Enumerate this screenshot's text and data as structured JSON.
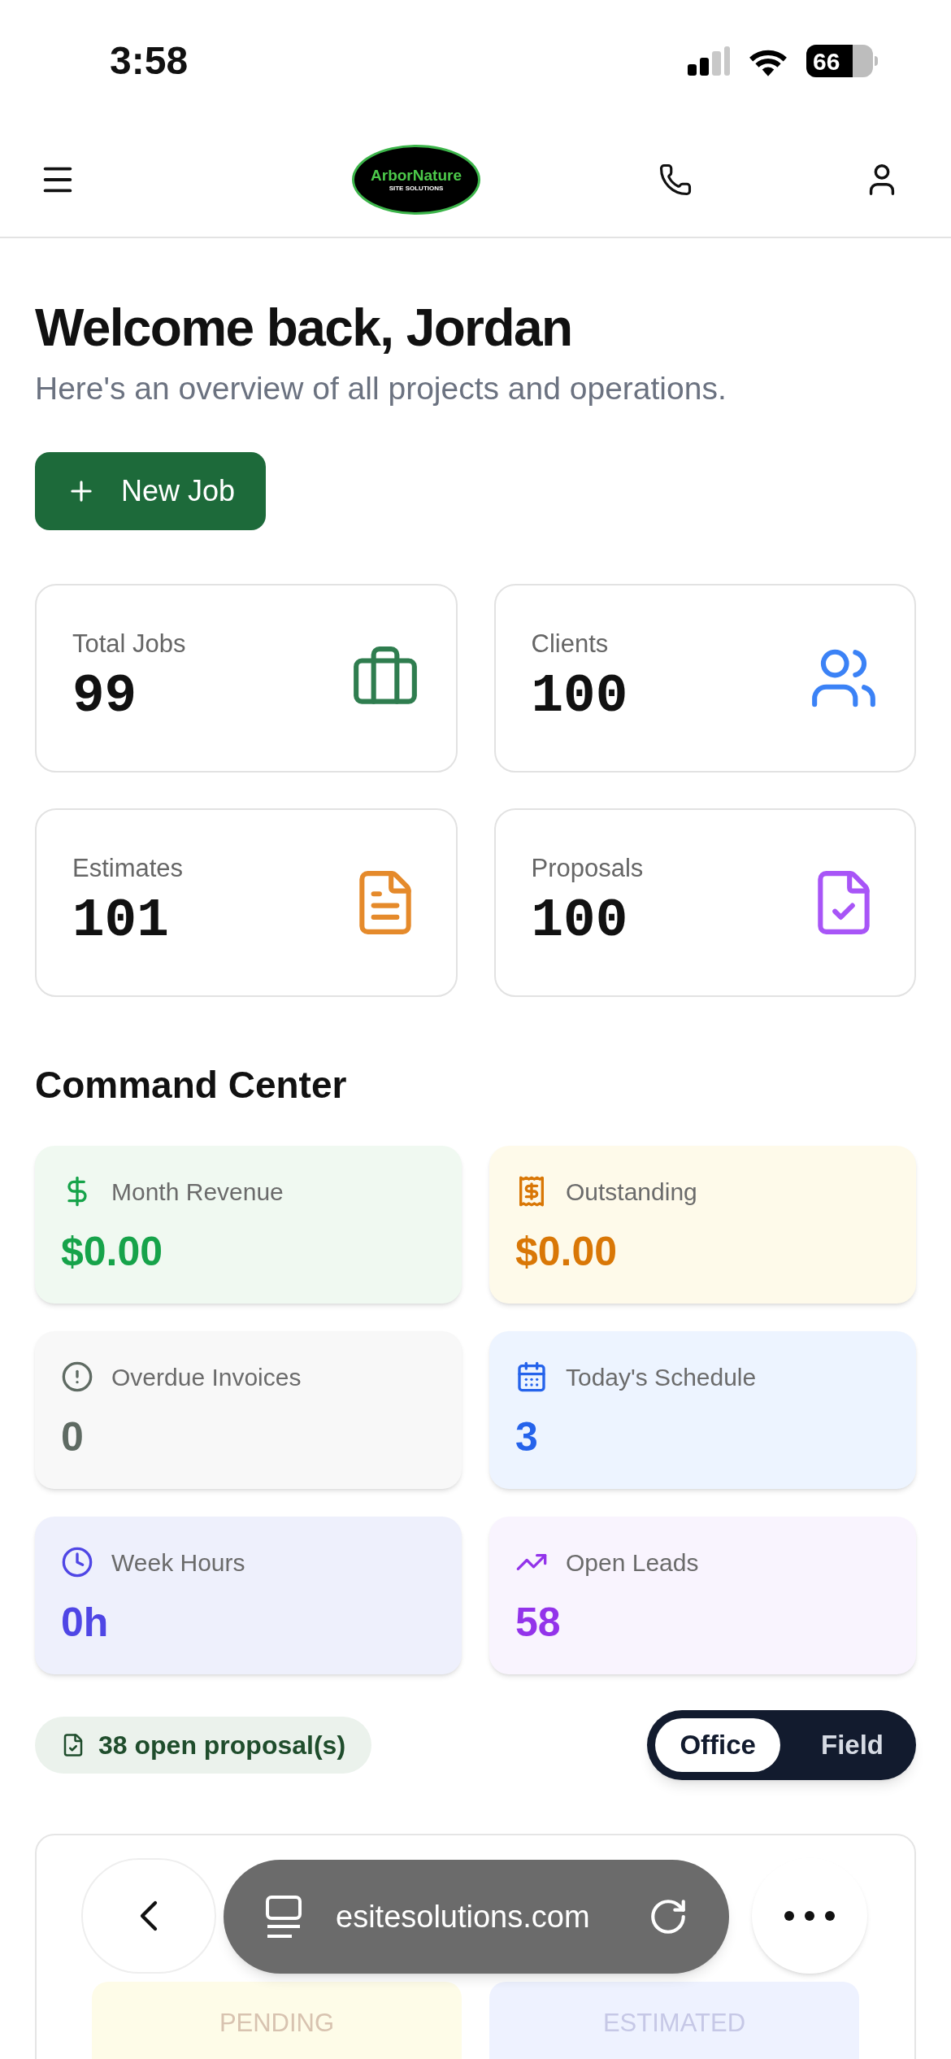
{
  "status_bar": {
    "time": "3:58",
    "battery": "66"
  },
  "header": {
    "logo": {
      "name": "ArborNature",
      "tagline": "SITE SOLUTIONS"
    }
  },
  "welcome": {
    "title": "Welcome back, Jordan",
    "subtitle": "Here's an overview of all projects and operations.",
    "new_job_button": "New Job"
  },
  "stats": [
    {
      "label": "Total Jobs",
      "value": "99",
      "color": "#2f7d4f"
    },
    {
      "label": "Clients",
      "value": "100",
      "color": "#3b82f6"
    },
    {
      "label": "Estimates",
      "value": "101",
      "color": "#e58a2b"
    },
    {
      "label": "Proposals",
      "value": "100",
      "color": "#a855f7"
    }
  ],
  "command_center": {
    "title": "Command Center",
    "cards": [
      {
        "label": "Month Revenue",
        "value": "$0.00",
        "color": "#16a34a"
      },
      {
        "label": "Outstanding",
        "value": "$0.00",
        "color": "#d97706"
      },
      {
        "label": "Overdue Invoices",
        "value": "0",
        "color": "#5f6b63"
      },
      {
        "label": "Today's Schedule",
        "value": "3",
        "color": "#2563eb"
      },
      {
        "label": "Week Hours",
        "value": "0h",
        "color": "#4f46e5"
      },
      {
        "label": "Open Leads",
        "value": "58",
        "color": "#9333ea"
      }
    ]
  },
  "proposals_pill": "38 open proposal(s)",
  "mode_toggle": [
    {
      "label": "Office",
      "selected": true
    },
    {
      "label": "Field",
      "selected": false
    }
  ],
  "job_status": {
    "tiles": [
      {
        "label": "PENDING",
        "color": "#fefce8"
      },
      {
        "label": "ESTIMATED",
        "color": "#eef2ff"
      }
    ]
  },
  "browser_bar": {
    "url": "esitesolutions.com"
  }
}
